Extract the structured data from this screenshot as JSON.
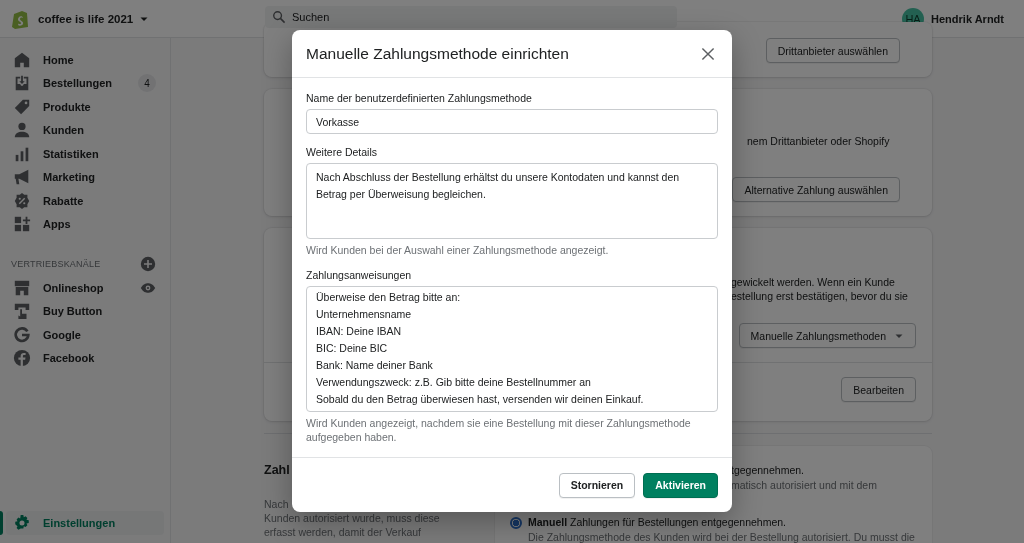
{
  "store": {
    "name": "coffee is life 2021"
  },
  "search": {
    "placeholder": "Suchen"
  },
  "user": {
    "initials": "HA",
    "name": "Hendrik Arndt"
  },
  "nav": [
    {
      "label": "Home",
      "selected": false
    },
    {
      "label": "Bestellungen",
      "badge": "4",
      "selected": false
    },
    {
      "label": "Produkte",
      "selected": false
    },
    {
      "label": "Kunden",
      "selected": false
    },
    {
      "label": "Statistiken",
      "selected": false
    },
    {
      "label": "Marketing",
      "selected": false
    },
    {
      "label": "Rabatte",
      "selected": false
    },
    {
      "label": "Apps",
      "selected": false
    }
  ],
  "channels": {
    "heading": "VERTRIEBSKANÄLE",
    "items": [
      {
        "label": "Onlineshop"
      },
      {
        "label": "Buy Button"
      },
      {
        "label": "Google"
      },
      {
        "label": "Facebook"
      }
    ]
  },
  "settings": {
    "label": "Einstellungen",
    "selected": true
  },
  "cards": [
    {
      "button": "Drittanbieter auswählen"
    },
    {
      "text": [
        "nem Drittanbieter oder Shopify"
      ],
      "button": "Alternative Zahlung auswählen"
    },
    {
      "text": [
        "gewickelt werden. Wenn ein Kunde",
        "estellung erst bestätigen, bevor du sie"
      ],
      "dropdown": "Manuelle Zahlungsmethoden",
      "footer_button": "Bearbeiten"
    }
  ],
  "capture": {
    "heading": "Zahl",
    "description": [
      "Nach",
      "Kunden autorisiert wurde, muss diese",
      "erfasst werden, damit der Verkauf"
    ],
    "options": [
      {
        "title": "tgegennehmen.",
        "detail": "matisch autorisiert und mit dem"
      },
      {
        "title": "**Manuell** Zahlungen für Bestellungen entgegennehmen.",
        "detail": "Die Zahlungsmethode des Kunden wird bei der Bestellung autorisiert. Du musst die",
        "selected": true
      }
    ]
  },
  "modal": {
    "title": "Manuelle Zahlungsmethode einrichten",
    "fields": [
      {
        "kind": "input",
        "label": "Name der benutzerdefinierten Zahlungsmethode",
        "value": "Vorkasse"
      },
      {
        "kind": "textarea",
        "label": "Weitere Details",
        "value": "Nach Abschluss der Bestellung erhältst du unsere Kontodaten und kannst den Betrag per Überweisung begleichen.",
        "help": "Wird Kunden bei der Auswahl einer Zahlungsmethode angezeigt."
      },
      {
        "kind": "textarea",
        "label": "Zahlungsanweisungen",
        "value": "Überweise den Betrag bitte an:\nUnternehmensname\nIBAN: Deine IBAN\nBIC: Deine BIC\nBank: Name deiner Bank\nVerwendungszweck: z.B. Gib bitte deine Bestellnummer an\nSobald du den Betrag überwiesen hast, versenden wir deinen Einkauf.",
        "help": "Wird Kunden angezeigt, nachdem sie eine Bestellung mit dieser Zahlungsmethode aufgegeben haben."
      }
    ],
    "buttons": [
      {
        "label": "Stornieren",
        "kind": "secondary"
      },
      {
        "label": "Aktivieren",
        "kind": "primary"
      }
    ]
  }
}
